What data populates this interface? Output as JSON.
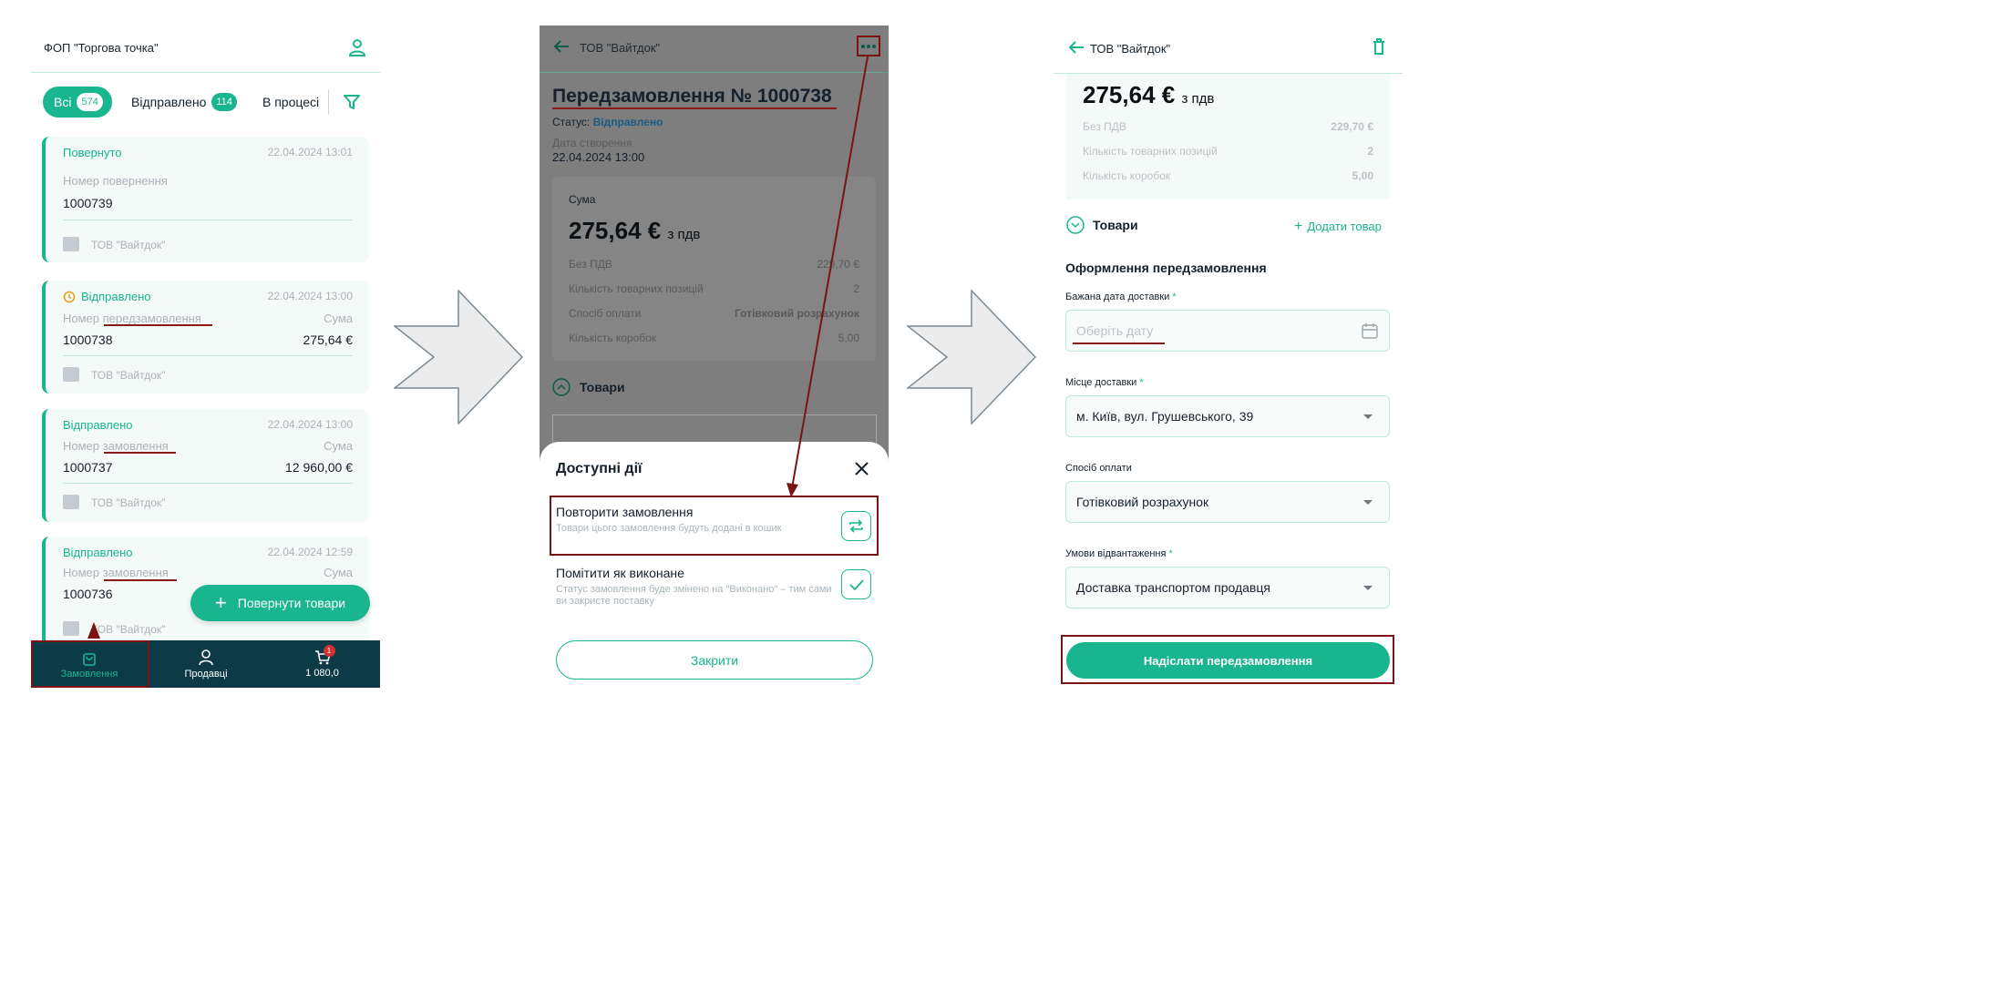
{
  "screen1": {
    "store_name": "ФОП \"Торгова точка\"",
    "filters": [
      {
        "label": "Всі",
        "count": "574"
      },
      {
        "label": "Відправлено",
        "count": "114"
      },
      {
        "label": "В процесі"
      }
    ],
    "cards": [
      {
        "status": "Повернуто",
        "date": "22.04.2024 13:01",
        "number_label": "Номер повернення",
        "number": "1000739",
        "sum_label": "",
        "sum": "",
        "company": "ТОВ \"Вайтдок\""
      },
      {
        "status": "Відправлено",
        "date": "22.04.2024 13:00",
        "number_label": "Номер передзамовлення",
        "number": "1000738",
        "sum_label": "Сума",
        "sum": "275,64 €",
        "company": "ТОВ \"Вайтдок\""
      },
      {
        "status": "Відправлено",
        "date": "22.04.2024 13:00",
        "number_label": "Номер замовлення",
        "number": "1000737",
        "sum_label": "Сума",
        "sum": "12 960,00 €",
        "company": "ТОВ \"Вайтдок\""
      },
      {
        "status": "Відправлено",
        "date": "22.04.2024 12:59",
        "number_label": "Номер замовлення",
        "number": "1000736",
        "sum_label": "Сума",
        "sum": "",
        "company": "ТОВ \"Вайтдок\""
      }
    ],
    "fab_label": "Повернути товари",
    "nav": [
      {
        "label": "Замовлення"
      },
      {
        "label": "Продавці"
      },
      {
        "label": "1 080,0",
        "badge": "1"
      }
    ]
  },
  "screen2": {
    "back_title": "ТОВ \"Вайтдок\"",
    "title": "Передзамовлення № 1000738",
    "status_label": "Статус:",
    "status_value": "Відправлено",
    "created_label": "Дата створення",
    "created_value": "22.04.2024 13:00",
    "sum_label": "Сума",
    "sum_value": "275,64 €",
    "sum_suffix": "з пдв",
    "rows": [
      {
        "label": "Без ПДВ",
        "value": "229,70 €"
      },
      {
        "label": "Кількість товарних позицій",
        "value": "2"
      },
      {
        "label": "Спосіб оплати",
        "value": "Готівковий розрахунок"
      },
      {
        "label": "Кількість коробок",
        "value": "5,00"
      }
    ],
    "goods_label": "Товари",
    "sheet_title": "Доступні дії",
    "actions": [
      {
        "title": "Повторити замовлення",
        "desc": "Товари цього замовлення будуть додані в кошик"
      },
      {
        "title": "Помітити як виконане",
        "desc": "Статус замовлення буде змінено на \"Виконано\" – тим сами ви закриєте поставку"
      }
    ],
    "close_label": "Закрити"
  },
  "screen3": {
    "back_title": "ТОВ \"Вайтдок\"",
    "sum_value": "275,64 €",
    "sum_suffix": "з пдв",
    "rows": [
      {
        "label": "Без ПДВ",
        "value": "229,70 €"
      },
      {
        "label": "Кількість товарних позицій",
        "value": "2"
      },
      {
        "label": "Кількість коробок",
        "value": "5,00"
      }
    ],
    "goods_label": "Товари",
    "add_goods_label": "Додати товар",
    "section_title": "Оформлення передзамовлення",
    "date_label": "Бажана дата доставки",
    "date_placeholder": "Оберіть дату",
    "place_label": "Місце доставки",
    "place_value": "м. Київ, вул. Грушевського, 39",
    "payment_label": "Спосіб оплати",
    "payment_value": "Готівковий розрахунок",
    "shipping_label": "Умови відвантаження",
    "shipping_value": "Доставка транспортом продавця",
    "submit_label": "Надіслати передзамовлення",
    "required_mark": "*"
  },
  "colors": {
    "accent": "#18b58f",
    "navbar": "#0d3a47",
    "annotation": "#7a1414",
    "status_blue": "#1b7fc4"
  }
}
